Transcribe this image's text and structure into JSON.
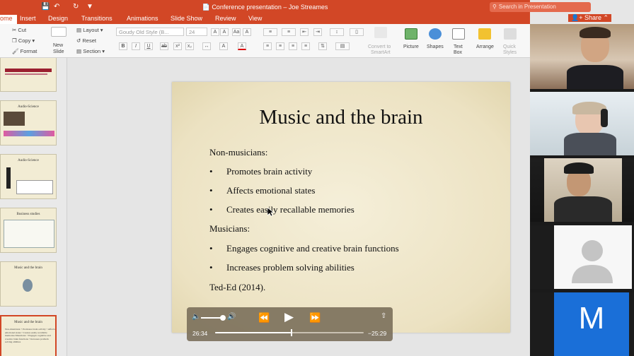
{
  "titlebar": {
    "title": "Conference presentation – Joe Streames",
    "search_placeholder": "Search in Presentation"
  },
  "tabs": [
    "ome",
    "Insert",
    "Design",
    "Transitions",
    "Animations",
    "Slide Show",
    "Review",
    "View"
  ],
  "share_label": "Share",
  "ribbon": {
    "cut": "Cut",
    "copy": "Copy",
    "format": "Format",
    "new_slide": [
      "New",
      "Slide"
    ],
    "layout": "Layout",
    "reset": "Reset",
    "section": "Section",
    "font_name": "Goudy Old Style (B...",
    "font_size": "24",
    "convert_smartart": [
      "Convert to",
      "SmartArt"
    ],
    "picture": "Picture",
    "shapes": "Shapes",
    "text_box": [
      "Text",
      "Box"
    ],
    "arrange": "Arrange",
    "quick_styles": [
      "Quick",
      "Styles"
    ]
  },
  "thumbnails": [
    {
      "title": "",
      "body": ""
    },
    {
      "title": "Audio-Science",
      "body": ""
    },
    {
      "title": "Audio-Science",
      "body": ""
    },
    {
      "title": "Business studies",
      "body": ""
    },
    {
      "title": "Music and the brain",
      "body": ""
    },
    {
      "title": "Music and the brain",
      "body": "Non-musicians: • Promotes brain activity • Affects emotional states • Creates easily recallable memories Musicians: • Engages cognitive and creative brain functions • Increases problem solving abilities"
    }
  ],
  "slide": {
    "title": "Music and the brain",
    "heading_1": "Non-musicians:",
    "bullets_1": [
      "Promotes brain activity",
      "Affects emotional states",
      "Creates easily recallable memories"
    ],
    "heading_2": "Musicians:",
    "bullets_2": [
      "Engages cognitive and creative brain functions",
      "Increases problem solving abilities"
    ],
    "citation": "Ted-Ed (2014).",
    "bullet_char": "•"
  },
  "player": {
    "elapsed": "26:34",
    "remaining": "−25:29",
    "progress": 0.51,
    "volume": 0.9
  },
  "participants": [
    {
      "name": ""
    },
    {
      "name": ""
    },
    {
      "name": ""
    },
    {
      "name": ""
    },
    {
      "initial": "M"
    }
  ],
  "colors": {
    "accent": "#d24726",
    "slide_bg": "#efe6c8",
    "avatar_blue": "#1a6fd8"
  }
}
